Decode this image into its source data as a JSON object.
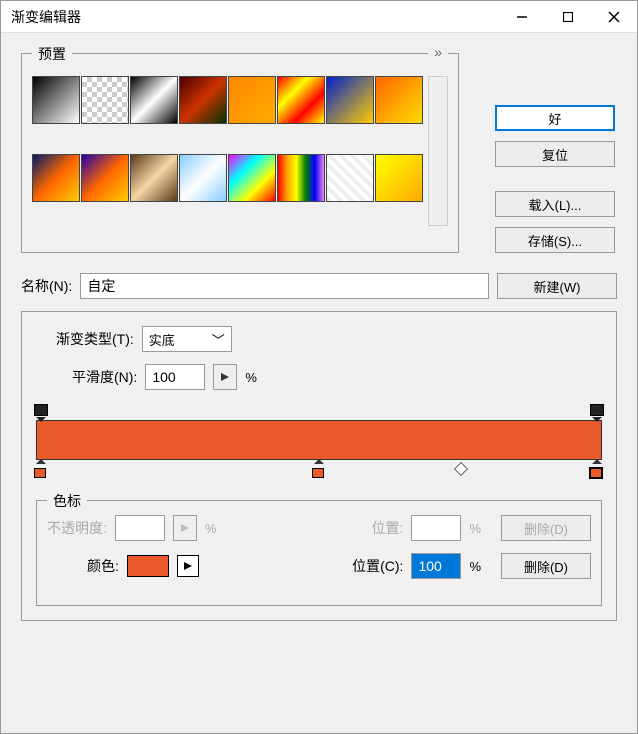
{
  "window": {
    "title": "渐变编辑器"
  },
  "presets": {
    "label": "预置",
    "expand": "»"
  },
  "buttons": {
    "ok": "好",
    "reset": "复位",
    "load": "载入(L)...",
    "save": "存储(S)...",
    "new": "新建(W)"
  },
  "name": {
    "label": "名称(N):",
    "value": "自定"
  },
  "gradient": {
    "type_label": "渐变类型(T):",
    "type_value": "实底",
    "smooth_label": "平滑度(N):",
    "smooth_value": "100",
    "smooth_unit": "%"
  },
  "stops": {
    "label": "色标",
    "opacity_label": "不透明度:",
    "opacity_value": "",
    "opacity_unit": "%",
    "opacity_pos_label": "位置:",
    "opacity_pos_value": "",
    "opacity_pos_unit": "%",
    "delete1": "删除(D)",
    "color_label": "颜色:",
    "color_value": "#e85a2a",
    "color_pos_label": "位置(C):",
    "color_pos_value": "100",
    "color_pos_unit": "%",
    "delete2": "删除(D)"
  },
  "gradient_bar": {
    "color_left": "#e85a2a",
    "color_right": "#e85a2a",
    "opacity_stops": [
      0,
      100
    ],
    "color_stops": [
      {
        "pos": 0,
        "color": "#e85a2a"
      },
      {
        "pos": 50,
        "color": "#e85a2a"
      },
      {
        "pos": 100,
        "color": "#e85a2a"
      }
    ],
    "midpoints": [
      75
    ]
  }
}
